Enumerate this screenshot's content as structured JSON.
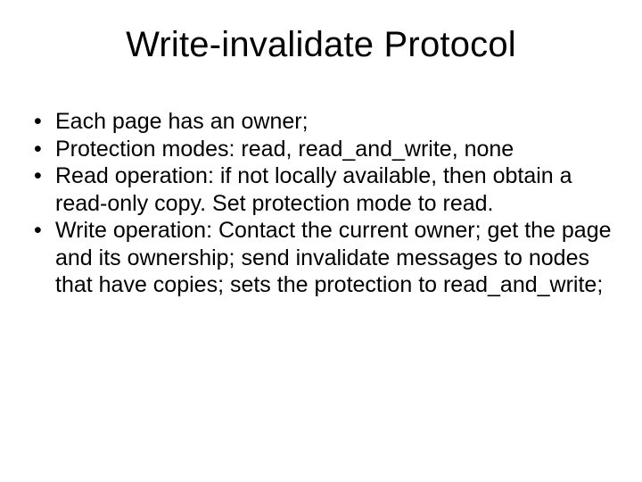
{
  "slide": {
    "title": "Write-invalidate Protocol",
    "bullets": [
      "Each page has an owner;",
      "Protection modes: read, read_and_write, none",
      "Read operation: if not locally available, then obtain a read-only copy. Set protection mode to read.",
      "Write operation: Contact the current owner; get the page and its ownership; send invalidate messages to nodes that have copies; sets the protection to read_and_write;"
    ]
  }
}
